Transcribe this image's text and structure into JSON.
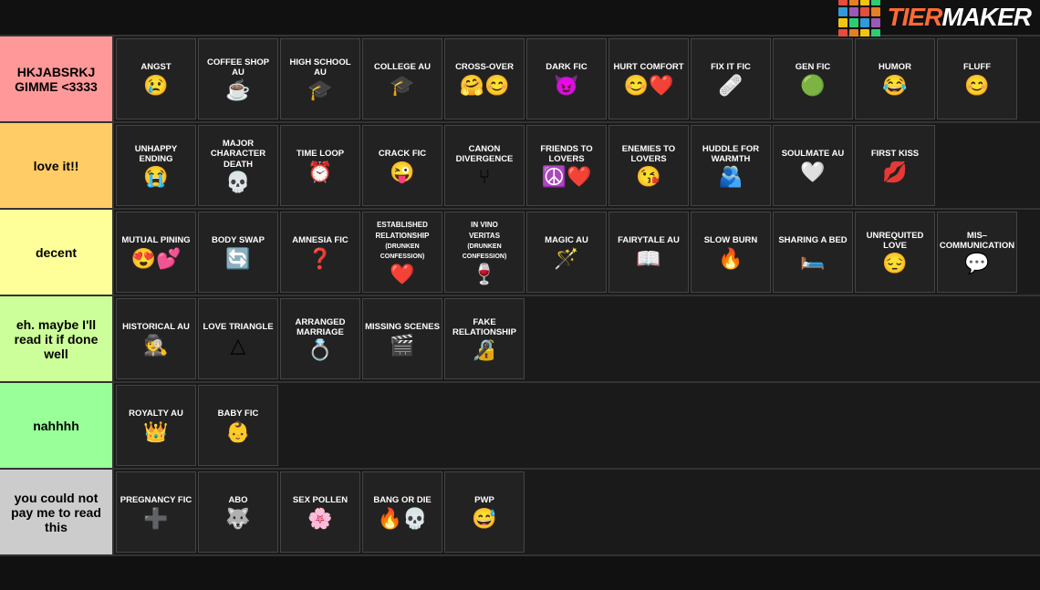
{
  "tiers": [
    {
      "id": "hkjab",
      "label": "HKJABSRKJ GIMME <3333",
      "color": "#ff9999",
      "items": [
        {
          "name": "ANGST",
          "emoji": "😢"
        },
        {
          "name": "COFFEE SHOP AU",
          "emoji": "☕"
        },
        {
          "name": "HIGH SCHOOL AU",
          "emoji": "🎓"
        },
        {
          "name": "COLLEGE AU",
          "emoji": "🎓"
        },
        {
          "name": "CROSS-OVER",
          "emoji": "🤗😊"
        },
        {
          "name": "DARK FIC",
          "emoji": "😈"
        },
        {
          "name": "HURT COMFORT",
          "emoji": "😊❤️"
        },
        {
          "name": "FIX IT FIC",
          "emoji": "🩹"
        },
        {
          "name": "GEN FIC",
          "emoji": "🟢"
        },
        {
          "name": "HUMOR",
          "emoji": "😂"
        },
        {
          "name": "FLUFF",
          "emoji": "😊"
        }
      ]
    },
    {
      "id": "love-it",
      "label": "love it!!",
      "color": "#ffcc66",
      "items": [
        {
          "name": "UNHAPPY ENDING",
          "emoji": "😭"
        },
        {
          "name": "MAJOR CHARACTER DEATH",
          "emoji": "💀"
        },
        {
          "name": "TIME LOOP",
          "emoji": "⏰"
        },
        {
          "name": "CRACK FIC",
          "emoji": "😜"
        },
        {
          "name": "CANON DIVERGENCE",
          "emoji": "⑂"
        },
        {
          "name": "FRIENDS TO LOVERS",
          "emoji": "☮️❤️"
        },
        {
          "name": "ENEMIES TO LOVERS",
          "emoji": "😘"
        },
        {
          "name": "HUDDLE FOR WARMTH",
          "emoji": "🫂"
        },
        {
          "name": "SOULMATE AU",
          "emoji": "🤍"
        },
        {
          "name": "FIRST KISS",
          "emoji": "💋"
        }
      ]
    },
    {
      "id": "decent",
      "label": "decent",
      "color": "#ffff99",
      "items": [
        {
          "name": "MUTUAL PINING",
          "emoji": "😍💕"
        },
        {
          "name": "BODY SWAP",
          "emoji": "🔄"
        },
        {
          "name": "AMNESIA FIC",
          "emoji": "❓"
        },
        {
          "name": "ESTABLISHED RELATIONSHIP (DRUNKEN CONFESSION)",
          "emoji": "❤️"
        },
        {
          "name": "IN VINO VERITAS (DRUNKEN CONFESSION)",
          "emoji": "🍷"
        },
        {
          "name": "MAGIC AU",
          "emoji": "🪄"
        },
        {
          "name": "FAIRYTALE AU",
          "emoji": "📖"
        },
        {
          "name": "SLOW BURN",
          "emoji": "🔥"
        },
        {
          "name": "SHARING A BED",
          "emoji": "🛏️"
        },
        {
          "name": "UNREQUITED LOVE",
          "emoji": "😔"
        },
        {
          "name": "MIS-COMMUNICATION",
          "emoji": "💬"
        }
      ]
    },
    {
      "id": "maybe",
      "label": "eh. maybe I'll read it if done well",
      "color": "#ccff99",
      "items": [
        {
          "name": "HISTORICAL AU",
          "emoji": "🕵️"
        },
        {
          "name": "LOVE TRIANGLE",
          "emoji": "△"
        },
        {
          "name": "ARRANGED MARRIAGE",
          "emoji": "💍"
        },
        {
          "name": "MISSING SCENES",
          "emoji": "🎬"
        },
        {
          "name": "FAKE RELATIONSHIP",
          "emoji": "🔏"
        }
      ]
    },
    {
      "id": "nahhhh",
      "label": "nahhhh",
      "color": "#99ff99",
      "items": [
        {
          "name": "ROYALTY AU",
          "emoji": "👑"
        },
        {
          "name": "BABY FIC",
          "emoji": "👶"
        }
      ]
    },
    {
      "id": "no-pay",
      "label": "you could not pay me to read this",
      "color": "#cccccc",
      "items": [
        {
          "name": "PREGNANCY FIC",
          "emoji": "➕"
        },
        {
          "name": "ABO",
          "emoji": "🐺"
        },
        {
          "name": "SEX POLLEN",
          "emoji": "🌸"
        },
        {
          "name": "BANG OR DIE",
          "emoji": "🔥💀"
        },
        {
          "name": "PWP",
          "emoji": "😅"
        }
      ]
    }
  ],
  "logo": {
    "text": "TIERMAKER",
    "colors": [
      "#ff0000",
      "#ff8800",
      "#ffff00",
      "#00cc00",
      "#0088ff",
      "#8800ff",
      "#ff00ff",
      "#ff0088"
    ]
  }
}
